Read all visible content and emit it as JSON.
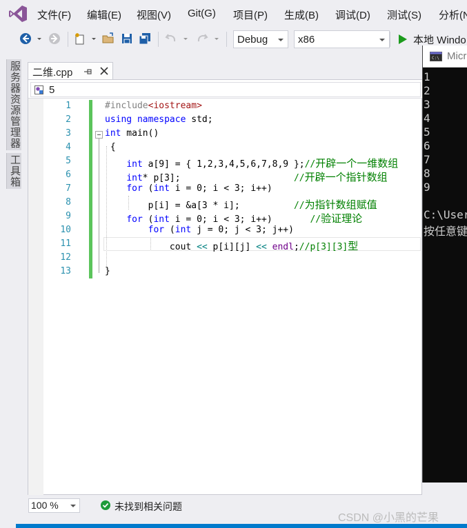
{
  "menu": {
    "items": [
      "文件(F)",
      "编辑(E)",
      "视图(V)",
      "Git(G)",
      "项目(P)",
      "生成(B)",
      "调试(D)",
      "测试(S)",
      "分析(N"
    ]
  },
  "toolbar": {
    "config_value": "Debug",
    "platform_value": "x86",
    "run_label": "本地 Windo"
  },
  "side_panel": {
    "tabs": [
      "服务器资源管理器",
      "工具箱"
    ]
  },
  "document_tab": {
    "label": "二维.cpp"
  },
  "navigation": {
    "location": "5"
  },
  "editor": {
    "line_numbers": [
      "1",
      "2",
      "3",
      "4",
      "5",
      "6",
      "7",
      "8",
      "9",
      "10",
      "11",
      "12",
      "13"
    ],
    "lines": [
      "#include<iostream>",
      "using namespace std;",
      "int main()",
      " {",
      "    int a[9] = { 1,2,3,4,5,6,7,8,9 };//开辟一个一维数组",
      "    int* p[3];                     //开辟一个指针数组",
      "    for (int i = 0; i < 3; i++)",
      "        p[i] = &a[3 * i];          //为指针数组赋值",
      "    for (int i = 0; i < 3; i++)       //验证理论",
      "        for (int j = 0; j < 3; j++)",
      "            cout << p[i][j] << endl;//p[3][3]型",
      "",
      "}"
    ]
  },
  "status": {
    "zoom": "100 %",
    "issues": "未找到相关问题"
  },
  "console": {
    "title": "Micr",
    "output": [
      "1",
      "2",
      "3",
      "4",
      "5",
      "6",
      "7",
      "8",
      "9",
      "",
      "C:\\User",
      "按任意键"
    ]
  },
  "watermark": "CSDN @小黑的芒果",
  "colors": {
    "keyword": "#0000ff",
    "comment": "#008000",
    "include": "#a31515",
    "line_number": "#2b91af",
    "change_bar": "#5bc45b",
    "status_accent": "#007acc"
  }
}
